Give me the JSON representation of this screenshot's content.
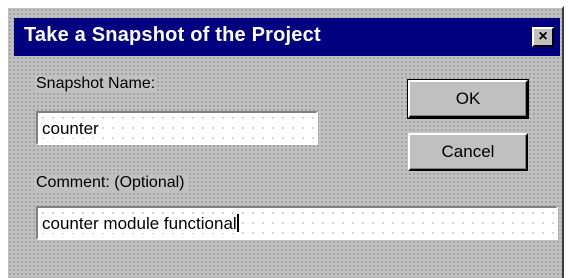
{
  "dialog": {
    "title": "Take a Snapshot of the Project",
    "close_glyph": "×"
  },
  "snapshot_name": {
    "label": "Snapshot Name:",
    "value": "counter"
  },
  "comment": {
    "label": "Comment: (Optional)",
    "value": "counter module functional"
  },
  "buttons": {
    "ok": "OK",
    "cancel": "Cancel"
  },
  "colors": {
    "titlebar": "#000080",
    "face": "#c0c0c0"
  }
}
